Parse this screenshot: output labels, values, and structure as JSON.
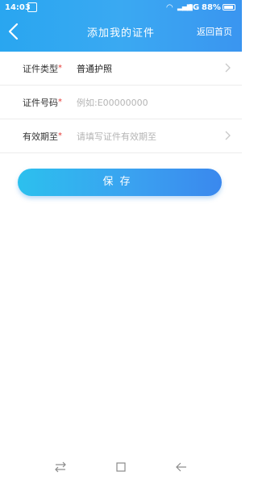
{
  "status_bar": {
    "time": "14:03",
    "network": "4G",
    "battery": "88%"
  },
  "header": {
    "title": "添加我的证件",
    "home_link": "返回首页"
  },
  "form": {
    "rows": [
      {
        "label": "证件类型",
        "value": "普通护照",
        "placeholder": ""
      },
      {
        "label": "证件号码",
        "value": "",
        "placeholder": "例如:E00000000"
      },
      {
        "label": "有效期至",
        "value": "",
        "placeholder": "请填写证件有效期至"
      }
    ],
    "required_mark": "*"
  },
  "save_button": {
    "label": "保存"
  },
  "colors": {
    "accent": "#3aa2f0",
    "header_gradient_start": "#29a6f0",
    "required": "#e53935",
    "placeholder": "#b4b4b4"
  },
  "icons": {
    "back": "chevron-left-icon",
    "row_arrow": "chevron-right-icon",
    "nav_recent": "switch-arrows-icon",
    "nav_home": "square-icon",
    "nav_back": "arrow-left-icon"
  }
}
